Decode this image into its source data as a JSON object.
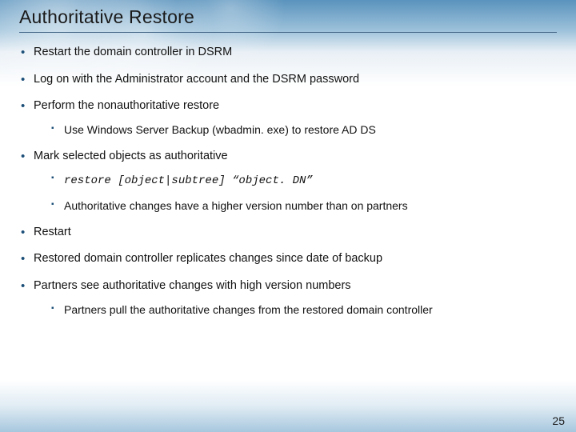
{
  "title": "Authoritative Restore",
  "pageNumber": "25",
  "bullets": {
    "b1": "Restart the domain controller in DSRM",
    "b2": "Log on with the Administrator account and the DSRM password",
    "b3": "Perform the nonauthoritative restore",
    "b3_1": "Use Windows Server Backup (wbadmin. exe) to restore AD DS",
    "b4": "Mark selected objects as authoritative",
    "b4_1": "restore [object|subtree] “object. DN”",
    "b4_2": "Authoritative changes have a higher version number than on partners",
    "b5": "Restart",
    "b6": "Restored domain controller replicates changes since date of backup",
    "b7": "Partners see authoritative changes with high version numbers",
    "b7_1": "Partners pull the authoritative changes from the restored domain controller"
  }
}
